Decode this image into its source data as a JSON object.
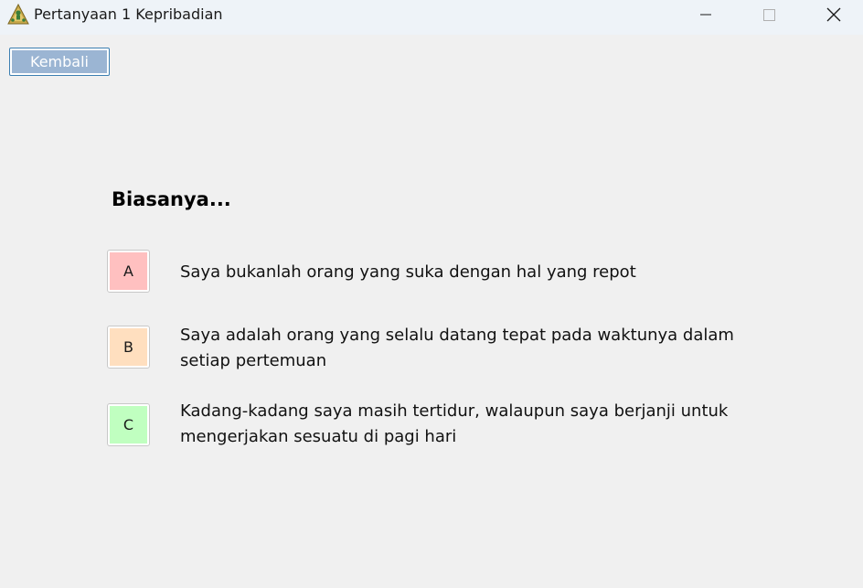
{
  "window": {
    "title": "Pertanyaan 1 Kepribadian",
    "app_icon": "pyramid-person-icon",
    "controls": {
      "minimize_icon": "minimize-icon",
      "maximize_icon": "maximize-icon",
      "close_icon": "close-icon"
    }
  },
  "toolbar": {
    "back_label": "Kembali"
  },
  "question": {
    "text": "Biasanya..."
  },
  "options": [
    {
      "letter": "A",
      "text": "Saya bukanlah orang yang suka dengan hal yang repot",
      "color": "#ffc0c0"
    },
    {
      "letter": "B",
      "text": "Saya adalah orang yang selalu datang tepat pada waktunya dalam setiap pertemuan",
      "color": "#ffdfbf"
    },
    {
      "letter": "C",
      "text": "Kadang-kadang saya masih tertidur, walaupun saya berjanji untuk mengerjakan sesuatu di pagi hari",
      "color": "#c0ffc0"
    }
  ]
}
